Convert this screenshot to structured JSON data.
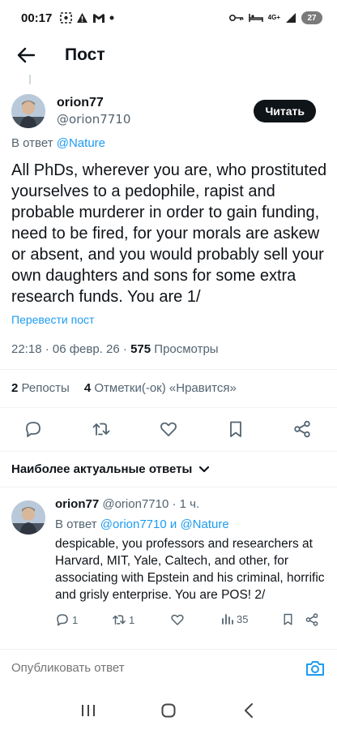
{
  "status_bar": {
    "time": "00:17",
    "left_icons": [
      "screenshot-icon",
      "warning-icon",
      "gmail-icon",
      "dot-icon"
    ],
    "right_icons": [
      "key-icon",
      "bed-icon",
      "network-4g-icon",
      "signal-icon"
    ],
    "network": "4G+",
    "battery": "27"
  },
  "header": {
    "title": "Пост"
  },
  "post": {
    "author_name": "orion77",
    "author_handle": "@orion7710",
    "follow_label": "Читать",
    "reply_prefix": "В ответ",
    "reply_to": "@Nature",
    "text": "All PhDs, wherever you are, who prostituted yourselves to a pedophile, rapist and probable murderer in order to gain funding, need to be fired, for your morals are askew or absent, and you would probably sell your own daughters and sons for some extra research funds. You are 1/",
    "translate_label": "Перевести пост",
    "timestamp": "22:18 · 06 февр. 26 · ",
    "views_count": "575",
    "views_label": "Просмотры",
    "reposts_count": "2",
    "reposts_label": "Репосты",
    "likes_count": "4",
    "likes_label": "Отметки(-ок) «Нравится»"
  },
  "sort_label": "Наиболее актуальные ответы",
  "reply": {
    "author_name": "orion77",
    "author_handle": "@orion7710",
    "time": "· 1 ч.",
    "reply_prefix": "В ответ",
    "reply_to_1": "@orion7710",
    "reply_joiner": "и",
    "reply_to_2": "@Nature",
    "text": "despicable, you professors and researchers at Harvard, MIT, Yale, Caltech, and other, for associating with Epstein and his criminal, horrific and grisly enterprise. You are POS! 2/",
    "replies_count": "1",
    "reposts_count": "1",
    "views_count": "35"
  },
  "compose": {
    "placeholder": "Опубликовать ответ"
  },
  "colors": {
    "accent": "#1d9bf0",
    "text": "#0f1419",
    "muted": "#536471",
    "divider": "#eff3f4"
  }
}
